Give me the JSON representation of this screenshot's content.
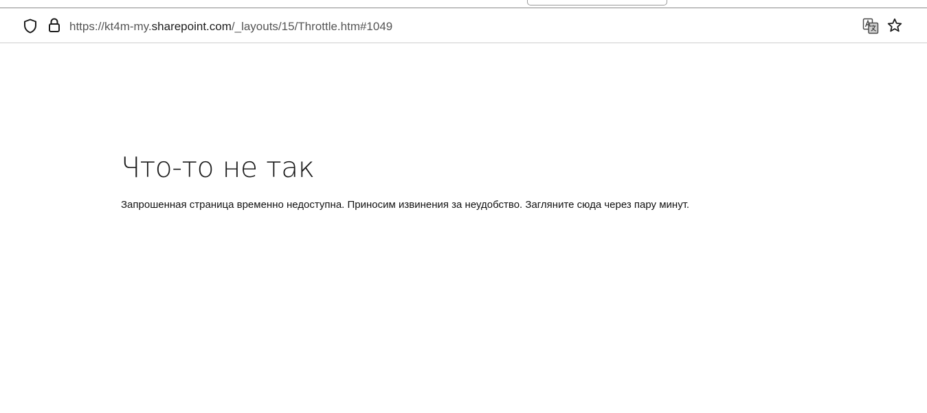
{
  "browser": {
    "url_prefix": "https://kt4m-my.",
    "url_host": "sharepoint.com",
    "url_path": "/_layouts/15/Throttle.htm#1049",
    "icons": {
      "shield": "shield-icon",
      "lock": "lock-icon",
      "translate": "translate-icon",
      "bookmark": "star-icon"
    }
  },
  "page": {
    "heading": "Что-то не так",
    "message": "Запрошенная страница временно недоступна. Приносим извинения за неудобство. Загляните сюда через пару минут."
  }
}
